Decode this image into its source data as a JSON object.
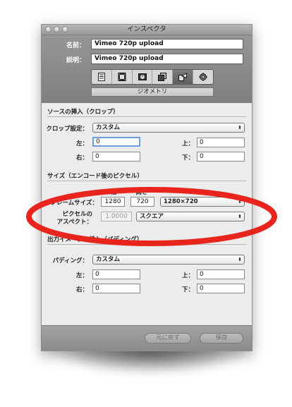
{
  "window": {
    "title": "インスペクタ"
  },
  "header": {
    "name_label": "名前：",
    "name_value": "Vimeo 720p upload",
    "desc_label": "説明：",
    "desc_value": "Vimeo 720p upload",
    "tabs": [
      {
        "icon": "summary-icon"
      },
      {
        "icon": "video-icon"
      },
      {
        "icon": "frame-controls-icon"
      },
      {
        "icon": "filters-icon"
      },
      {
        "icon": "geometry-icon"
      },
      {
        "icon": "actions-icon"
      }
    ],
    "active_tab_label": "ジオメトリ"
  },
  "crop": {
    "section_title": "ソースの挿入（クロップ）",
    "setting_label": "クロップ設定：",
    "setting_value": "カスタム",
    "left_label": "左：",
    "left_value": "0",
    "top_label": "上：",
    "top_value": "0",
    "right_label": "右：",
    "right_value": "0",
    "bottom_label": "下：",
    "bottom_value": "0"
  },
  "size": {
    "section_title": "サイズ（エンコード後のピクセル）",
    "width_head": "幅",
    "height_head": "高さ",
    "frame_size_label": "フレームサイズ：",
    "width_value": "1280",
    "height_value": "720",
    "frame_size_select": "1280×720",
    "pixel_aspect_label_1": "ピクセルの",
    "pixel_aspect_label_2": "アスペクト：",
    "pixel_aspect_value": "1.0000",
    "pixel_aspect_select": "スクエア"
  },
  "output": {
    "section_title": "出力イメージの挿入（パディング）",
    "padding_label": "パディング：",
    "padding_value": "カスタム",
    "left_label": "左：",
    "left_value": "0",
    "top_label": "上：",
    "top_value": "0",
    "right_label": "右：",
    "right_value": "0",
    "bottom_label": "下：",
    "bottom_value": "0"
  },
  "footer": {
    "revert_label": "元に戻す",
    "save_label": "保存"
  },
  "colors": {
    "annotation": "#e8241c",
    "focus": "#6f9ddb"
  }
}
